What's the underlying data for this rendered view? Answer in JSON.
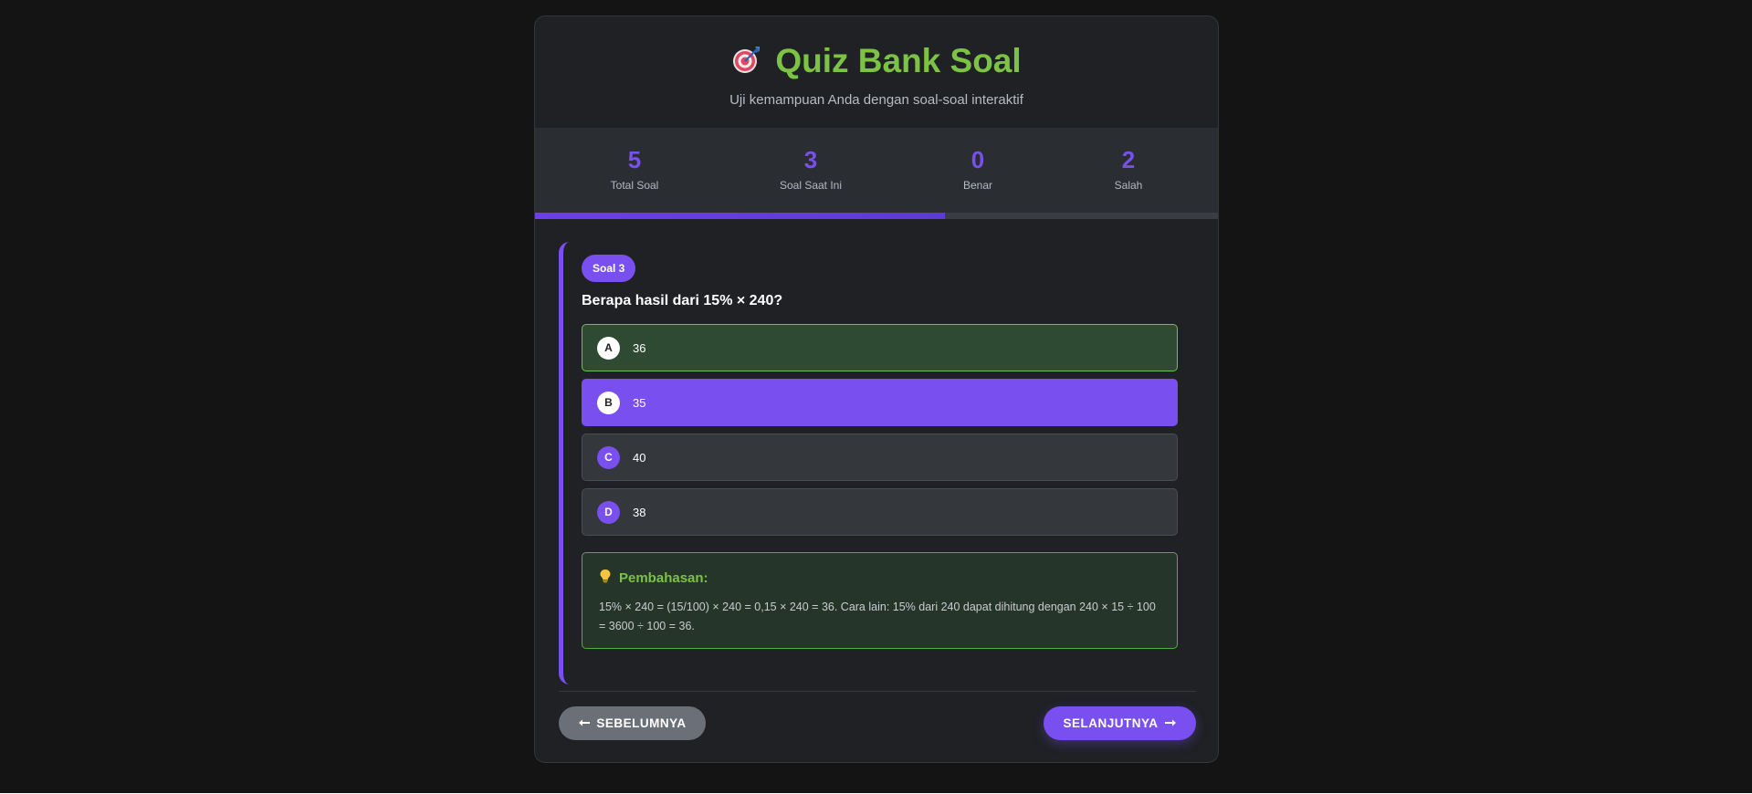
{
  "header": {
    "icon": "target-icon",
    "title": "Quiz Bank Soal",
    "subtitle": "Uji kemampuan Anda dengan soal-soal interaktif"
  },
  "stats": [
    {
      "value": "5",
      "label": "Total Soal"
    },
    {
      "value": "3",
      "label": "Soal Saat Ini"
    },
    {
      "value": "0",
      "label": "Benar"
    },
    {
      "value": "2",
      "label": "Salah"
    }
  ],
  "progress": {
    "percent": 60
  },
  "question": {
    "badge": "Soal 3",
    "text": "Berapa hasil dari 15% × 240?",
    "options": [
      {
        "letter": "A",
        "text": "36",
        "state": "correct"
      },
      {
        "letter": "B",
        "text": "35",
        "state": "selected"
      },
      {
        "letter": "C",
        "text": "40",
        "state": "normal"
      },
      {
        "letter": "D",
        "text": "38",
        "state": "normal"
      }
    ]
  },
  "explanation": {
    "icon": "lightbulb-icon",
    "title": "Pembahasan:",
    "text": "15% × 240 = (15/100) × 240 = 0,15 × 240 = 36. Cara lain: 15% dari 240 dapat dihitung dengan 240 × 15 ÷ 100 = 3600 ÷ 100 = 36."
  },
  "nav": {
    "prev_icon": "arrow-left-icon",
    "prev_label": "SEBELUMNYA",
    "next_label": "SELANJUTNYA",
    "next_icon": "arrow-right-icon"
  },
  "colors": {
    "accent": "#7a4ff0",
    "success": "#7cc244",
    "background": "#141414",
    "card": "#1f2125"
  }
}
